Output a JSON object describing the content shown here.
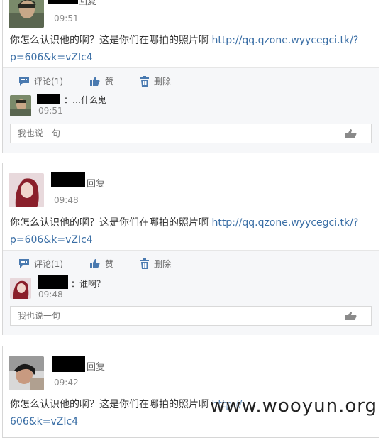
{
  "posts": [
    {
      "action": "回复",
      "time": "09:51",
      "text_main": "你怎么认识他的啊？这是你们在哪拍的照片啊 ",
      "text_link": "http://qq.qzone.wyycegci.tk/?p=606&k=vZIc4",
      "toolbar": {
        "comment": "评论(1)",
        "like": "赞",
        "delete": "删除"
      },
      "comment": {
        "text": "：…什么鬼",
        "time": "09:51"
      },
      "reply_placeholder": "我也说一句",
      "avatar_colors": {
        "bg": "#7a8a6a",
        "face": "#c8a888",
        "hair": "#2a2a22"
      }
    },
    {
      "action": "回复",
      "time": "09:48",
      "text_main": "你怎么认识他的啊？这是你们在哪拍的照片啊 ",
      "text_link": "http://qq.qzone.wyycegci.tk/?p=606&k=vZIc4",
      "toolbar": {
        "comment": "评论(1)",
        "like": "赞",
        "delete": "删除"
      },
      "comment": {
        "text": "：谁啊？",
        "time": "09:48"
      },
      "reply_placeholder": "我也说一句",
      "avatar_colors": {
        "bg": "#e8d9dc",
        "face": "#f0d6cc",
        "hair": "#8a1f2a"
      }
    },
    {
      "action": "回复",
      "time": "09:42",
      "text_main": "你怎么认识他的啊？这是你们在哪拍的照片啊 ",
      "text_link": "http://",
      "text_link2": "606&k=vZIc4",
      "avatar_colors": {
        "bg": "#d8d8d8",
        "face": "#c89a80",
        "hair": "#1a1a1a"
      }
    }
  ],
  "watermark": "www.wooyun.org",
  "icons": [
    "comment-icon",
    "thumbs-up-icon",
    "trash-icon",
    "like-button-icon"
  ]
}
